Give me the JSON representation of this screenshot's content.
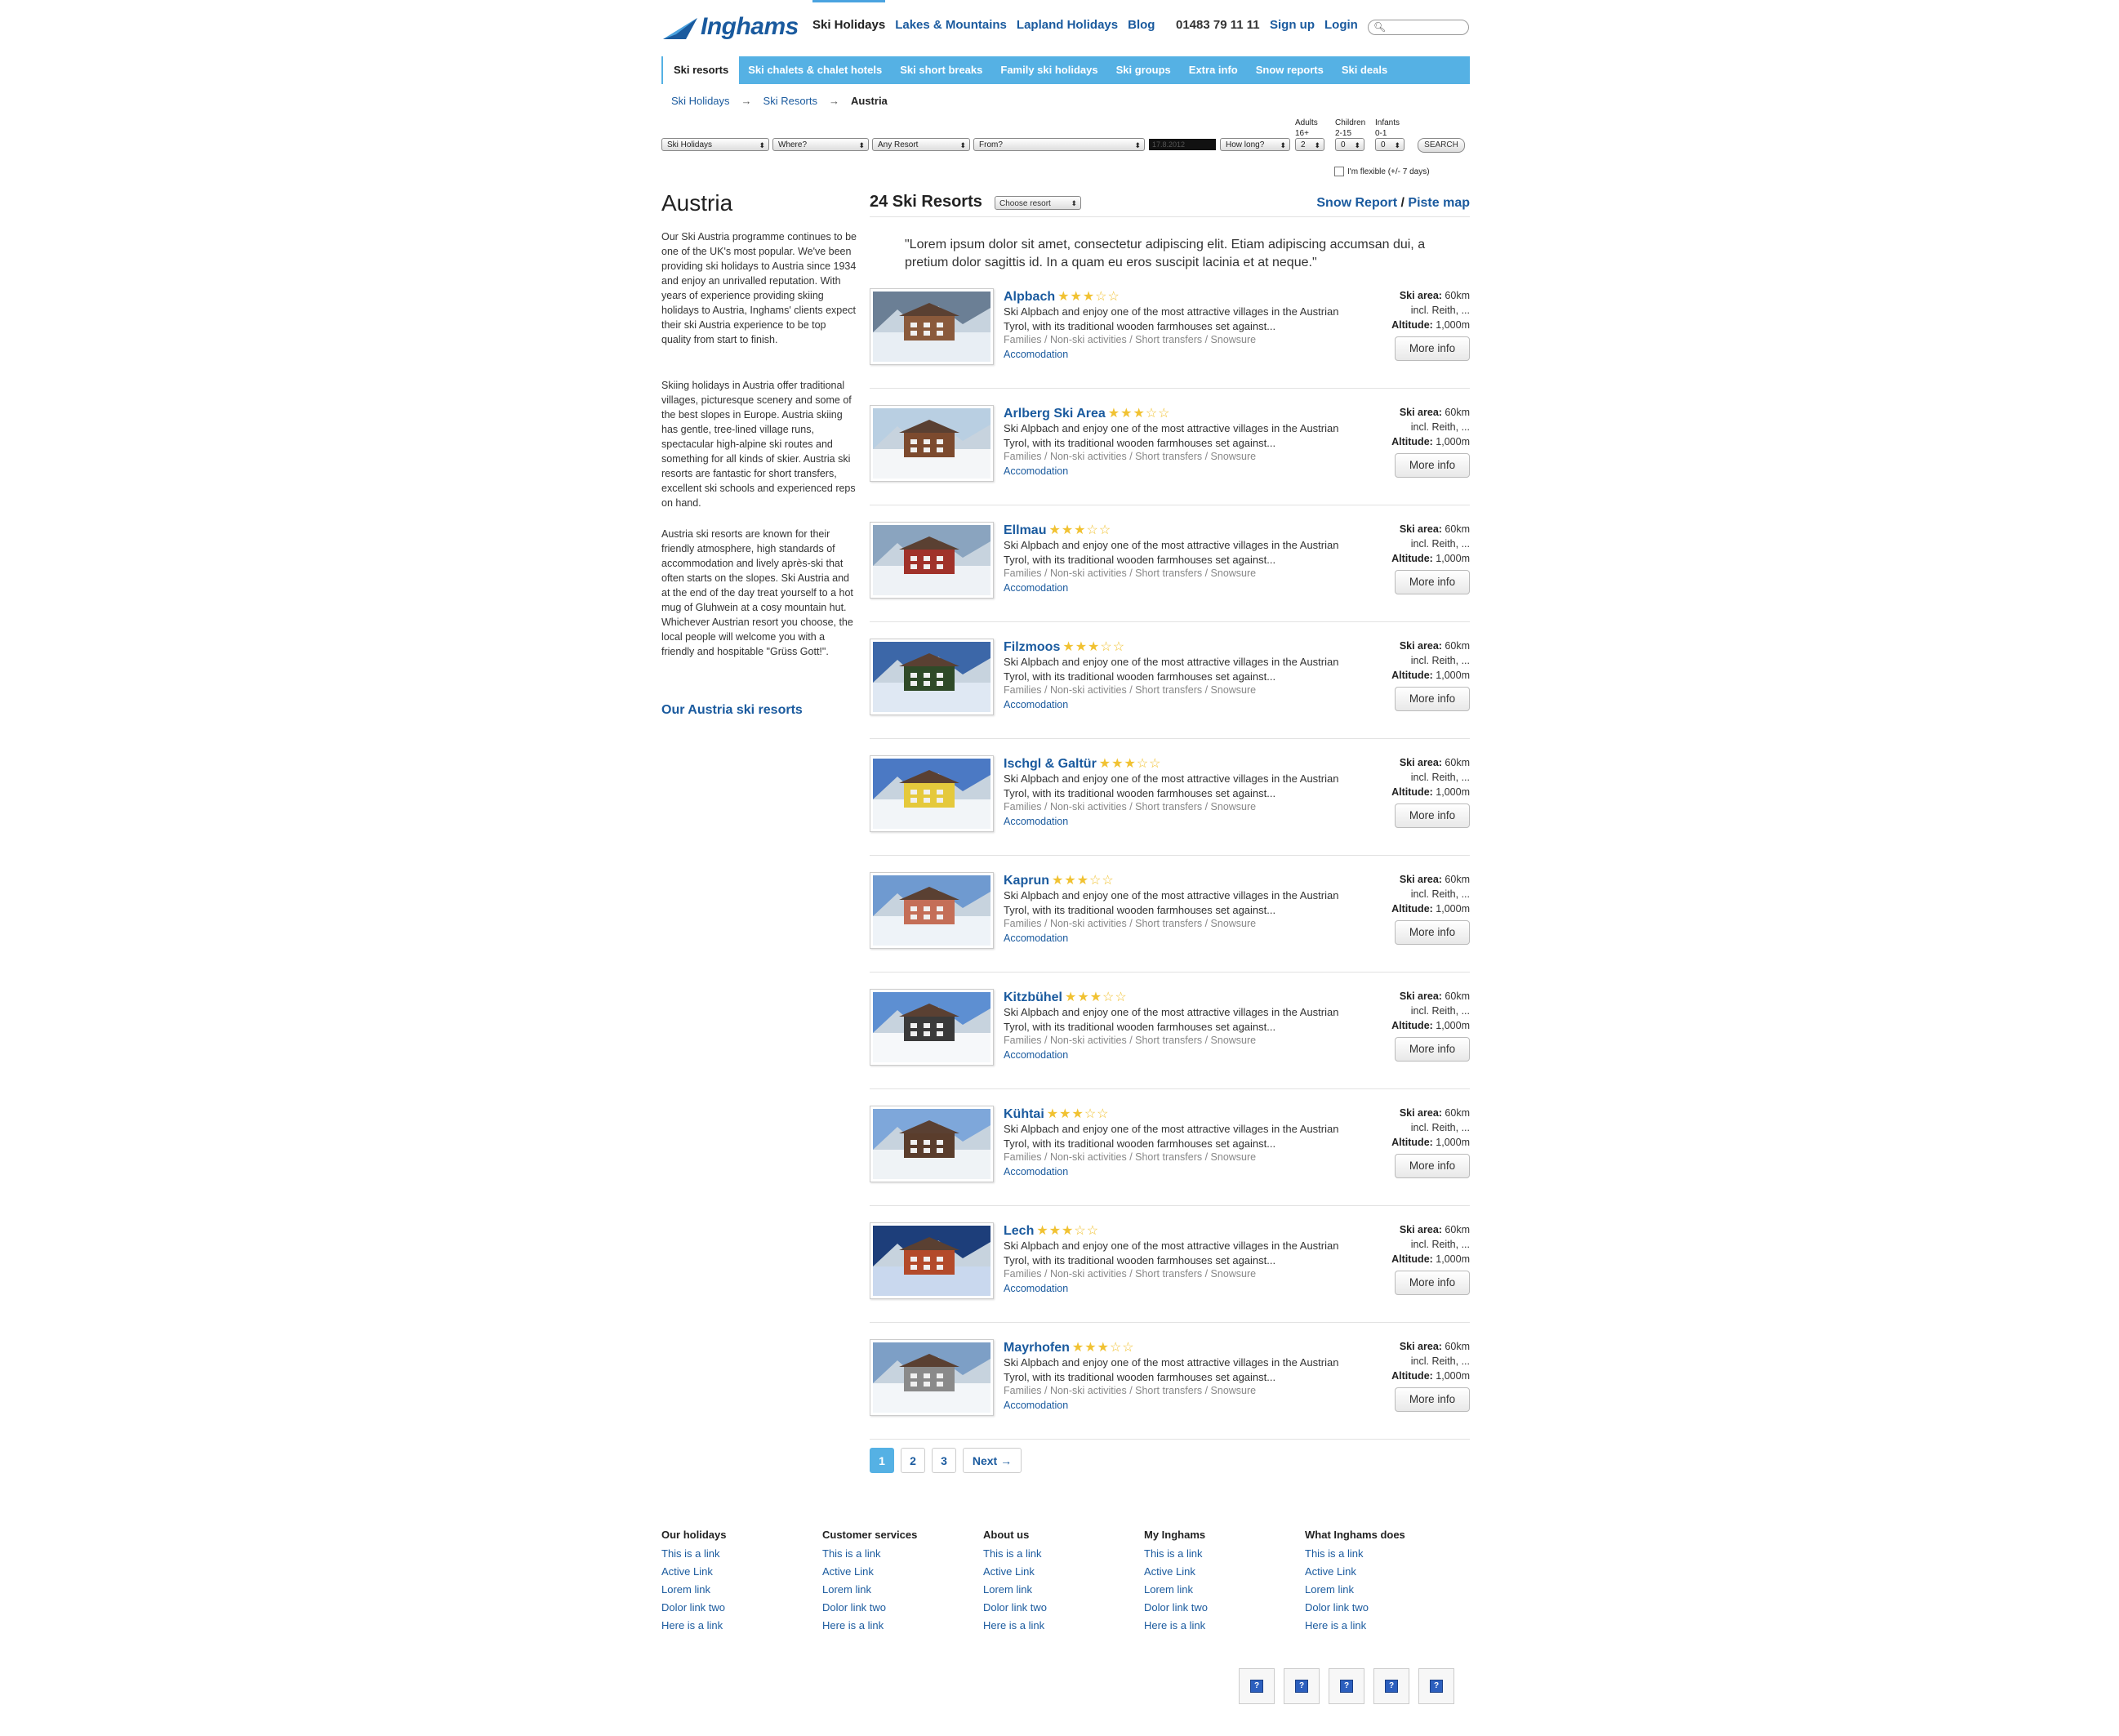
{
  "brand": {
    "name": "Inghams"
  },
  "topnav": {
    "items": [
      "Ski Holidays",
      "Lakes & Mountains",
      "Lapland Holidays",
      "Blog"
    ]
  },
  "phone": "01483 79 11 11",
  "toplinks": {
    "signup": "Sign up",
    "login": "Login"
  },
  "bluenav": {
    "items": [
      "Ski resorts",
      "Ski chalets & chalet hotels",
      "Ski short breaks",
      "Family ski holidays",
      "Ski groups",
      "Extra info",
      "Snow reports",
      "Ski deals"
    ]
  },
  "breadcrumb": {
    "items": [
      "Ski Holidays",
      "Ski Resorts",
      "Austria"
    ],
    "sep": "→"
  },
  "searchform": {
    "type": "Ski Holidays",
    "where": "Where?",
    "resort": "Any Resort",
    "from": "From?",
    "date": "17.8.2012",
    "howlong": "How long?",
    "adults_label": "Adults",
    "adults_range": "16+",
    "adults_val": "2",
    "children_label": "Children",
    "children_range": "2-15",
    "children_val": "0",
    "infants_label": "Infants",
    "infants_range": "0-1",
    "infants_val": "0",
    "search_btn": "SEARCH",
    "flexible": "I'm flexible (+/- 7 days)"
  },
  "left": {
    "title": "Austria",
    "p1": "Our Ski Austria programme continues to be one of the UK's most popular. We've been providing ski holidays to Austria since 1934 and enjoy an unrivalled reputation. With years of experience providing skiing holidays to Austria, Inghams' clients expect their ski Austria experience to be top quality from start to finish.",
    "p2": "Skiing holidays in Austria offer traditional villages, picturesque scenery and some of the best slopes in Europe. Austria skiing has gentle, tree-lined village runs, spectacular high-alpine ski routes and something for all kinds of skier. Austria ski resorts are fantastic for short transfers, excellent ski schools and experienced reps on hand.",
    "p3": "Austria ski resorts are known for their friendly atmosphere, high standards of accommodation and lively après-ski that often starts on the slopes. Ski Austria and at the end of the day treat yourself to a hot mug of Gluhwein at a cosy mountain hut. Whichever Austrian resort you choose, the local people will welcome you with a friendly and hospitable \"Grüss Gott!\".",
    "link": "Our Austria ski resorts"
  },
  "main": {
    "title": "24 Ski Resorts",
    "choose": "Choose resort",
    "snow": "Snow Report",
    "slash": "/",
    "piste": "Piste map",
    "quote": "\"Lorem ipsum dolor sit amet, consectetur adipiscing elit. Etiam adipiscing accumsan dui, a pretium dolor sagittis id. In a quam eu eros suscipit lacinia et at neque.\""
  },
  "resort_common": {
    "desc": "Ski Alpbach and enjoy one of the most attractive villages in the Austrian Tyrol, with its traditional wooden farmhouses set against...",
    "tags": "Families / Non-ski activities / Short transfers / Snowsure",
    "acc": "Accomodation",
    "skiarea_label": "Ski area:",
    "skiarea": "60km",
    "incl": "incl. Reith, ...",
    "alt_label": "Altitude:",
    "alt": "1,000m",
    "more": "More info",
    "stars": "★★★☆☆"
  },
  "resorts": [
    {
      "name": "Alpbach"
    },
    {
      "name": "Arlberg Ski Area"
    },
    {
      "name": "Ellmau"
    },
    {
      "name": "Filzmoos"
    },
    {
      "name": "Ischgl & Galtür"
    },
    {
      "name": "Kaprun"
    },
    {
      "name": "Kitzbühel"
    },
    {
      "name": "Kühtai"
    },
    {
      "name": "Lech"
    },
    {
      "name": "Mayrhofen"
    }
  ],
  "pagination": {
    "pages": [
      "1",
      "2",
      "3"
    ],
    "next": "Next →"
  },
  "footer": [
    {
      "head": "Our holidays",
      "links": [
        "This is a link",
        "Active Link",
        "Lorem link",
        "Dolor link two",
        "Here is a link"
      ]
    },
    {
      "head": "Customer services",
      "links": [
        "This is a link",
        "Active Link",
        "Lorem link",
        "Dolor link two",
        "Here is a link"
      ]
    },
    {
      "head": "About us",
      "links": [
        "This is a link",
        "Active Link",
        "Lorem link",
        "Dolor link two",
        "Here is a link"
      ]
    },
    {
      "head": "My Inghams",
      "links": [
        "This is a link",
        "Active Link",
        "Lorem link",
        "Dolor link two",
        "Here is a link"
      ]
    },
    {
      "head": "What Inghams does",
      "links": [
        "This is a link",
        "Active Link",
        "Lorem link",
        "Dolor link two",
        "Here is a link"
      ]
    }
  ],
  "footer_icons": [
    "broken-image-icon",
    "broken-image-icon",
    "broken-image-icon",
    "broken-image-icon",
    "broken-image-icon"
  ],
  "colors": {
    "brand_blue": "#1a5a9e",
    "nav_blue": "#55b1e4",
    "star": "#f1c232"
  }
}
